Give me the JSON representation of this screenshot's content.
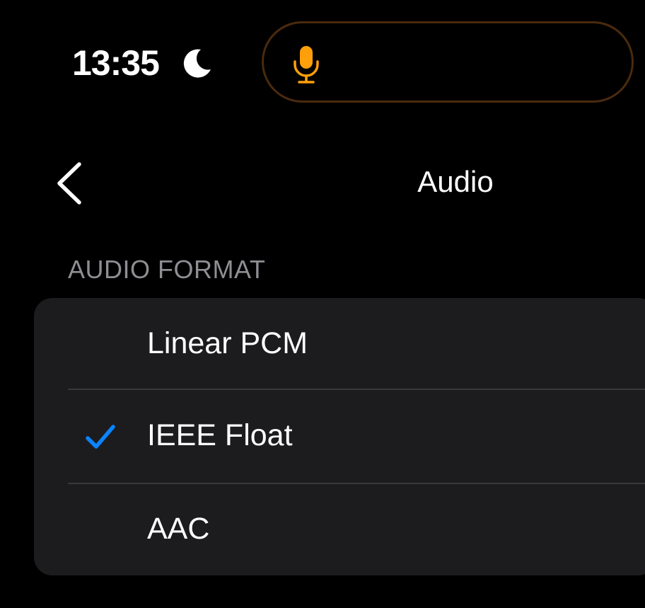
{
  "status_bar": {
    "time": "13:35",
    "focus_icon": "moon-icon",
    "mic_indicator_icon": "microphone-icon",
    "mic_color": "#ff9f0a"
  },
  "nav": {
    "back_icon": "chevron-left-icon",
    "title": "Audio"
  },
  "section": {
    "header": "AUDIO FORMAT",
    "options": [
      {
        "label": "Linear PCM",
        "selected": false
      },
      {
        "label": "IEEE Float",
        "selected": true
      },
      {
        "label": "AAC",
        "selected": false
      }
    ],
    "checkmark_color": "#0a84ff"
  }
}
